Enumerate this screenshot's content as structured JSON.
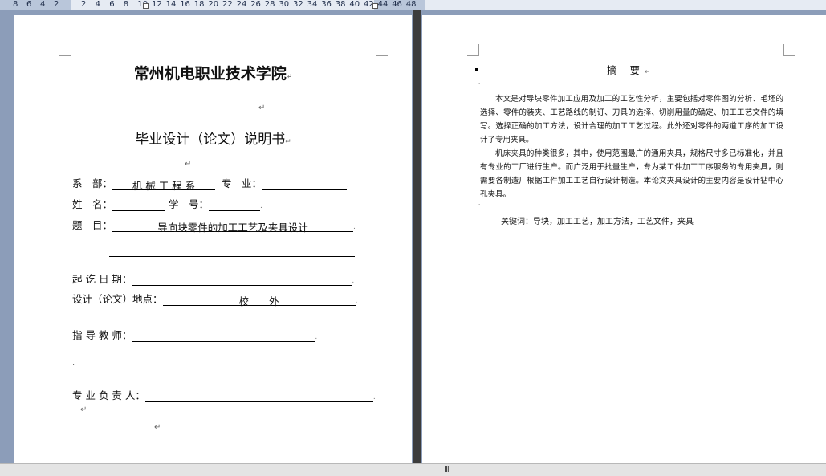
{
  "ruler": {
    "ticks": [
      "8",
      "6",
      "4",
      "2",
      "2",
      "4",
      "6",
      "8",
      "10",
      "12",
      "14",
      "16",
      "18",
      "20",
      "22",
      "24",
      "26",
      "28",
      "30",
      "32",
      "34",
      "36",
      "38",
      "40",
      "42",
      "44",
      "46",
      "48"
    ]
  },
  "cover": {
    "school": "常州机电职业技术学院",
    "title": "毕业设计（论文）说明书",
    "dept_label": "系　部：",
    "dept_value": "机 械 工 程 系",
    "major_label": "专　业：",
    "major_value": "",
    "name_label": "姓　名：",
    "name_value": "",
    "id_label": "学　号：",
    "id_value": "",
    "topic_label": "题　目：",
    "topic_value": "导向块零件的加工工艺及夹具设计",
    "date_label": "起 讫 日 期：",
    "date_value": "",
    "location_label": "设计（论文）地点：",
    "location_value": "校　　外",
    "advisor_label": "指 导 教 师：",
    "advisor_value": "",
    "head_label": "专 业 负 责 人：",
    "head_value": ""
  },
  "abstract": {
    "title": "摘 要",
    "para1": "本文是对导块零件加工应用及加工的工艺性分析，主要包括对零件图的分析、毛坯的选择、零件的装夹、工艺路线的制订、刀具的选择、切削用量的确定、加工工艺文件的填写。选择正确的加工方法，设计合理的加工工艺过程。此外还对零件的两道工序的加工设计了专用夹具。",
    "para2": "机床夹具的种类很多，其中，使用范围最广的通用夹具，规格尺寸多已标准化，并且有专业的工厂进行生产。而广泛用于批量生产，专为某工件加工工序服务的专用夹具，则需要各制造厂根据工件加工工艺自行设计制造。本论文夹具设计的主要内容是设计钻中心孔夹具。",
    "keywords_label": "关键词：",
    "keywords_value": "导块，加工工艺，加工方法，工艺文件，夹具"
  },
  "statusbar": {
    "grip": "III"
  }
}
